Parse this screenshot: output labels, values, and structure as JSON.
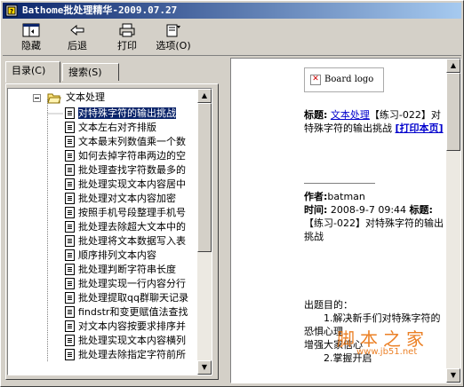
{
  "window": {
    "title": "Bathome批处理精华-2009.07.27"
  },
  "toolbar": {
    "hide": "隐藏",
    "back": "后退",
    "print": "打印",
    "options": "选项(O)"
  },
  "tabs": [
    {
      "label": "目录(C)",
      "active": true
    },
    {
      "label": "搜索(S)",
      "active": false
    }
  ],
  "tree": {
    "folder": "文本处理",
    "items": [
      "对特殊字符的输出挑战",
      "文本左右对齐排版",
      "文本最末列数值乘一个数",
      "如何去掉字符串两边的空",
      "批处理查找字符数最多的",
      "批处理实现文本内容居中",
      "批处理对文本内容加密",
      "按照手机号段整理手机号",
      "批处理去除超大文本中的",
      "批处理将文本数据写入表",
      "顺序排列文本内容",
      "批处理判断字符串长度",
      "批处理实现一行内容分行",
      "批处理提取qq群聊天记录",
      "findstr和变更赋值法查找",
      "对文本内容按要求排序并",
      "批处理实现文本内容横列",
      "批处理去除指定字符前所"
    ],
    "selected_index": 0
  },
  "content": {
    "logo_text": "Board logo",
    "title_label": "标题:",
    "title_link": "文本处理",
    "title_rest": "【练习-022】对特殊字符的输出挑战",
    "print_link": "[打印本页]",
    "author_label": "作者:",
    "author": "batman",
    "time_label": "时间:",
    "time": "2008-9-7 09:44",
    "title2_label": "标题:",
    "title2": "【练习-022】对特殊字符的输出挑战",
    "purpose_label": "出题目的：",
    "purpose_1": "1.解决新手们对特殊字符的恐惧心理",
    "purpose_2": "增强大家信心",
    "purpose_3": "2.掌握开启"
  },
  "watermark": {
    "text": "脚本之家",
    "url": "www.jb51.net"
  },
  "colors": {
    "title_start": "#0a246a",
    "title_end": "#a6caf0",
    "selection": "#0a246a",
    "link": "#0000cc",
    "watermark": "#e86a00"
  }
}
